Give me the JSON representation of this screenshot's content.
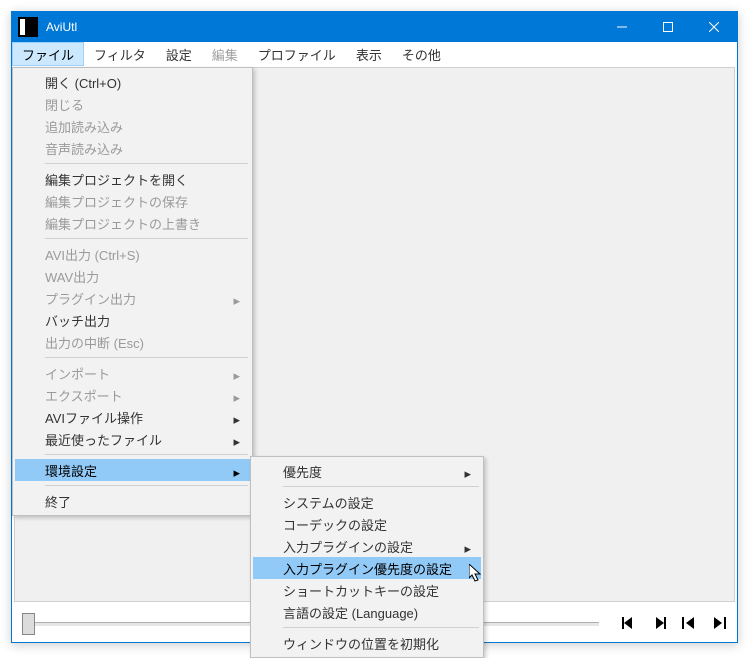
{
  "window": {
    "title": "AviUtl"
  },
  "menubar": {
    "file": "ファイル",
    "filter": "フィルタ",
    "settings": "設定",
    "edit": "編集",
    "profile": "プロファイル",
    "view": "表示",
    "other": "その他"
  },
  "file_menu": {
    "open": "開く (Ctrl+O)",
    "close": "閉じる",
    "append_load": "追加読み込み",
    "audio_load": "音声読み込み",
    "open_project": "編集プロジェクトを開く",
    "save_project": "編集プロジェクトの保存",
    "overwrite_project": "編集プロジェクトの上書き",
    "avi_out": "AVI出力 (Ctrl+S)",
    "wav_out": "WAV出力",
    "plugin_out": "プラグイン出力",
    "batch_out": "バッチ出力",
    "abort_out": "出力の中断 (Esc)",
    "import": "インポート",
    "export": "エクスポート",
    "avi_file_ops": "AVIファイル操作",
    "recent": "最近使ったファイル",
    "env": "環境設定",
    "exit": "終了"
  },
  "env_submenu": {
    "priority": "優先度",
    "system": "システムの設定",
    "codec": "コーデックの設定",
    "input_plugin": "入力プラグインの設定",
    "input_plugin_priority": "入力プラグイン優先度の設定",
    "shortcut": "ショートカットキーの設定",
    "language": "言語の設定 (Language)",
    "reset_window_pos": "ウィンドウの位置を初期化"
  }
}
